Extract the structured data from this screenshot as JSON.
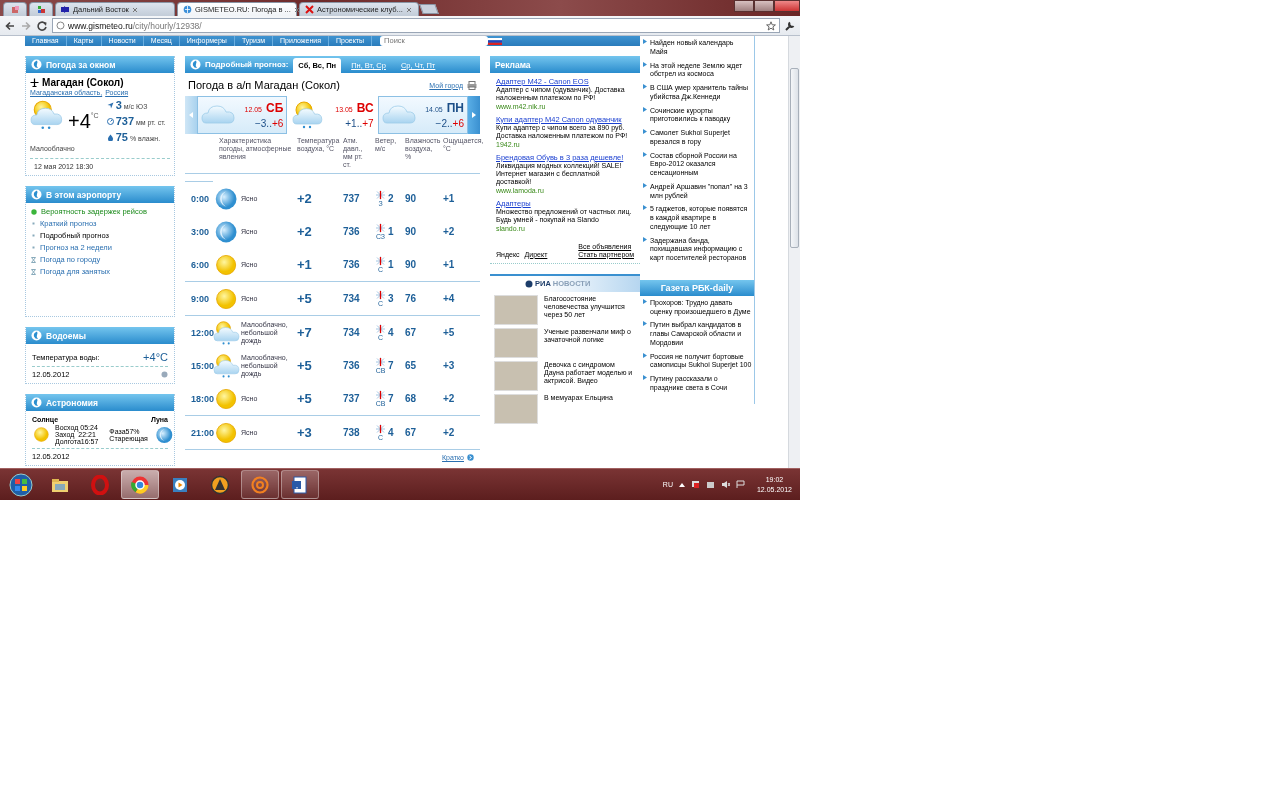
{
  "browser": {
    "tabs": [
      {
        "selected": false
      },
      {
        "selected": false
      },
      {
        "title": "Дальний Восток",
        "selected": false
      },
      {
        "title": "GISMETEO.RU: Погода в ...",
        "selected": true
      },
      {
        "title": "Астрономические клуб...",
        "selected": false
      }
    ],
    "url_host": "www.gismeteo.ru",
    "url_path": "/city/hourly/12938/"
  },
  "site_nav": {
    "items": [
      "Главная",
      "Карты",
      "Новости",
      "Месяц",
      "Информеры",
      "Туризм",
      "Приложения",
      "Проекты"
    ],
    "search_placeholder": "Поиск"
  },
  "weather_now": {
    "title": "Погода за окном",
    "city": "Магадан (Сокол)",
    "region": "Магаданская область,",
    "country": "Россия",
    "temperature": "+4",
    "temp_unit": "°C",
    "wind_speed": "3",
    "wind_unit": "м/с",
    "wind_dir": "ЮЗ",
    "pressure": "737",
    "pressure_unit": "мм рт. ст.",
    "humidity": "75",
    "humidity_unit": "% влажн.",
    "condition": "Малооблачно",
    "updated": "12 мая 2012 18:30"
  },
  "airport": {
    "title": "В этом аэропорту",
    "links": [
      {
        "label": "Вероятность задержек рейсов",
        "kind": "status",
        "selected": false
      },
      {
        "label": "Краткий прогноз",
        "kind": "bullet",
        "selected": false
      },
      {
        "label": "Подробный прогноз",
        "kind": "bullet",
        "selected": true
      },
      {
        "label": "Прогноз на 2 недели",
        "kind": "bullet",
        "selected": false
      },
      {
        "label": "Погода по городу",
        "kind": "sub",
        "selected": false
      },
      {
        "label": "Погода для занятых",
        "kind": "sub",
        "selected": false
      }
    ]
  },
  "water": {
    "title": "Водоемы",
    "label": "Температура воды:",
    "value": "+4°C",
    "date": "12.05.2012"
  },
  "astronomy": {
    "title": "Астрономия",
    "sun_label": "Солнце",
    "moon_label": "Луна",
    "sun_lines": [
      "Восход 05:24",
      "Заход  22:21",
      "Долгота16:57"
    ],
    "moon_lines": [
      "Фаза57%",
      "Стареющая"
    ],
    "date": "12.05.2012"
  },
  "forecast": {
    "label": "Подробный прогноз:",
    "tabs": [
      {
        "label": "Сб, Вс, Пн",
        "selected": true
      },
      {
        "label": "Пн, Вт, Ср",
        "selected": false
      },
      {
        "label": "Ср, Чт, Пт",
        "selected": false
      }
    ],
    "title": "Погода в а/п Магадан (Сокол)",
    "my_city": "Мой город",
    "days": [
      {
        "date": "12.05",
        "day": "СБ",
        "weekend": true,
        "low": "−3..",
        "high": "+6",
        "kind": "cloud",
        "highlighted": true
      },
      {
        "date": "13.05",
        "day": "ВС",
        "weekend": true,
        "low": "+1..",
        "high": "+7",
        "kind": "sun-cloud-rain",
        "highlighted": false
      },
      {
        "date": "14.05",
        "day": "ПН",
        "weekend": false,
        "low": "−2..",
        "high": "+6",
        "kind": "cloud",
        "highlighted": true
      }
    ],
    "columns": [
      "Характеристика погоды, атмосферные явления",
      "Температура воздуха, °C",
      "Атм. давл., мм рт. ст.",
      "Ветер, м/с",
      "Влажность воздуха, %",
      "Ощущается, °C"
    ],
    "periods": [
      {
        "rows": [
          {
            "time": "0:00",
            "kind": "moon",
            "description": "Ясно",
            "temperature": "+2",
            "pressure": "737",
            "wind_dir": "З",
            "wind_speed": "2",
            "humidity": "90",
            "feels_like": "+1"
          },
          {
            "time": "3:00",
            "kind": "moon",
            "description": "Ясно",
            "temperature": "+2",
            "pressure": "736",
            "wind_dir": "СЗ",
            "wind_speed": "1",
            "humidity": "90",
            "feels_like": "+2"
          },
          {
            "time": "6:00",
            "kind": "sun",
            "description": "Ясно",
            "temperature": "+1",
            "pressure": "736",
            "wind_dir": "С",
            "wind_speed": "1",
            "humidity": "90",
            "feels_like": "+1"
          }
        ]
      },
      {
        "rows": [
          {
            "time": "9:00",
            "kind": "sun",
            "description": "Ясно",
            "temperature": "+5",
            "pressure": "734",
            "wind_dir": "С",
            "wind_speed": "3",
            "humidity": "76",
            "feels_like": "+4"
          }
        ]
      },
      {
        "rows": [
          {
            "time": "12:00",
            "kind": "sun-cloud-rain",
            "description": "Малооблачно, небольшой дождь",
            "temperature": "+7",
            "pressure": "734",
            "wind_dir": "С",
            "wind_speed": "4",
            "humidity": "67",
            "feels_like": "+5"
          },
          {
            "time": "15:00",
            "kind": "sun-cloud-rain",
            "description": "Малооблачно, небольшой дождь",
            "temperature": "+5",
            "pressure": "736",
            "wind_dir": "СВ",
            "wind_speed": "7",
            "humidity": "65",
            "feels_like": "+3"
          },
          {
            "time": "18:00",
            "kind": "sun",
            "description": "Ясно",
            "temperature": "+5",
            "pressure": "737",
            "wind_dir": "СВ",
            "wind_speed": "7",
            "humidity": "68",
            "feels_like": "+2"
          }
        ]
      },
      {
        "rows": [
          {
            "time": "21:00",
            "kind": "sun",
            "description": "Ясно",
            "temperature": "+3",
            "pressure": "738",
            "wind_dir": "С",
            "wind_speed": "4",
            "humidity": "67",
            "feels_like": "+2"
          }
        ]
      }
    ],
    "brief_link": "Кратко"
  },
  "ads": {
    "title": "Реклама",
    "items": [
      {
        "title": "Адаптер M42 - Canon EOS",
        "text": "Адаптер с чипом (одуванчик). Доставка наложенным платежом по РФ!",
        "url": "www.m42.nik.ru"
      },
      {
        "title": "Купи адаптер M42 Canon одуванчик",
        "text": "Купи адаптер с чипом всего за 890 руб. Доставка наложенным платежом по РФ!",
        "url": "1942.ru"
      },
      {
        "title": "Брендовая Обувь в 3 раза дешевле!",
        "text": "Ликвидация модных коллекций! SALE! Интернет магазин с бесплатной доставкой!",
        "url": "www.lamoda.ru"
      },
      {
        "title": "Адаптеры",
        "text": "Множество предложений от частных лиц. Будь умней - покупай на Slando",
        "url": "slando.ru"
      }
    ],
    "yandex": "Яндекс",
    "direct": "Директ",
    "all_ads": "Все объявления",
    "become_partner": "Стать партнером"
  },
  "ria": {
    "logo_a": "РИА",
    "logo_b": "НОВОСТИ",
    "items": [
      "Благосостояние человечества улучшится через 50 лет",
      "Ученые развенчали миф о зачаточной логике",
      "Девочка с синдромом Дауна работает моделью и актрисой. Видео",
      "В мемуарах Ельцина"
    ]
  },
  "news": {
    "items": [
      "Найден новый календарь Майя",
      "На этой неделе Землю ждет обстрел из космоса",
      "В США умер хранитель тайны убийства Дж.Кеннеди",
      "Сочинские курорты приготовились к паводку",
      "Самолет Sukhoi Superjet врезался в гору",
      "Состав сборной России на Евро-2012 оказался сенсационным",
      "Андрей Аршавин \"попал\" на 3 млн рублей",
      "5 гаджетов, которые появятся в каждой квартире в следующие 10 лет",
      "Задержана банда, похищавшая информацию с карт посетителей ресторанов"
    ]
  },
  "rbk": {
    "title": "Газета РБК-daily",
    "items": [
      "Прохоров: Трудно давать оценку произошедшего в Думе",
      "Путин выбрал кандидатов в главы Самарской области и Мордовии",
      "Россия не получит бортовые самописцы Sukhoi Superjet 100",
      "Путину рассказали о празднике света в Сочи"
    ]
  },
  "taskbar": {
    "apps": [
      {
        "running": false,
        "selected": false
      },
      {
        "running": false,
        "selected": false
      },
      {
        "running": true,
        "selected": true
      },
      {
        "running": false,
        "selected": false
      },
      {
        "running": false,
        "selected": false
      },
      {
        "running": true,
        "selected": false
      },
      {
        "running": true,
        "selected": false
      }
    ],
    "language": "RU",
    "time": "19:02",
    "date": "12.05.2012"
  }
}
